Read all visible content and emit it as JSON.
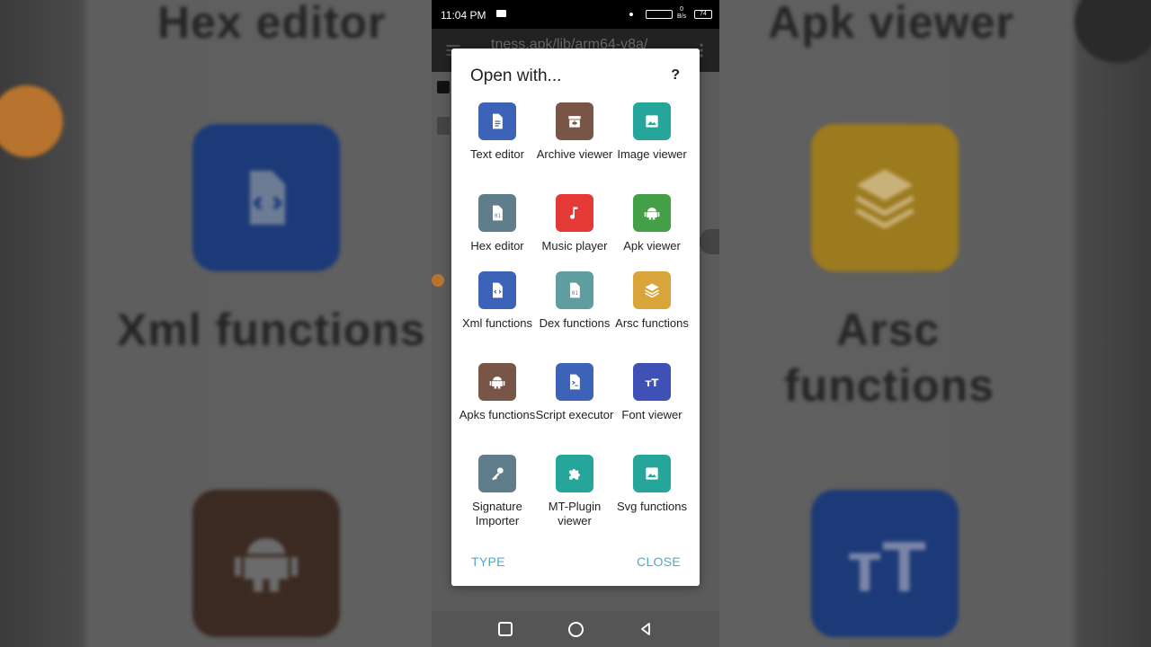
{
  "status_bar": {
    "time": "11:04 PM",
    "speed_top": "0",
    "speed_bottom": "B/s",
    "battery": "74"
  },
  "app_bar": {
    "path": "tness.apk/lib/arm64-v8a/"
  },
  "dialog": {
    "title": "Open with...",
    "help_label": "?",
    "type_button": "TYPE",
    "close_button": "CLOSE",
    "items": [
      {
        "label": "Text editor",
        "icon": "text-document-icon",
        "color": "#3d63b8"
      },
      {
        "label": "Archive viewer",
        "icon": "archive-box-icon",
        "color": "#795548"
      },
      {
        "label": "Image viewer",
        "icon": "image-icon",
        "color": "#26a69a"
      },
      {
        "label": "Hex editor",
        "icon": "binary-file-icon",
        "color": "#607d8b"
      },
      {
        "label": "Music player",
        "icon": "music-note-icon",
        "color": "#e53935"
      },
      {
        "label": "Apk viewer",
        "icon": "android-icon",
        "color": "#43a047"
      },
      {
        "label": "Xml functions",
        "icon": "code-file-icon",
        "color": "#3d63b8"
      },
      {
        "label": "Dex functions",
        "icon": "binary-file-icon",
        "color": "#5f9ea0"
      },
      {
        "label": "Arsc functions",
        "icon": "layers-icon",
        "color": "#d9a43a"
      },
      {
        "label": "Apks functions",
        "icon": "android-icon",
        "color": "#795548"
      },
      {
        "label": "Script executor",
        "icon": "terminal-file-icon",
        "color": "#3d63b8"
      },
      {
        "label": "Font viewer",
        "icon": "font-icon",
        "color": "#3f51b5"
      },
      {
        "label": "Signature Importer",
        "icon": "key-icon",
        "color": "#607d8b"
      },
      {
        "label": "MT-Plugin viewer",
        "icon": "puzzle-icon",
        "color": "#26a69a"
      },
      {
        "label": "Svg functions",
        "icon": "image-icon",
        "color": "#26a69a"
      }
    ]
  },
  "background": {
    "left_top_text": "Hex editor",
    "left_mid_text": "Xml functions",
    "right_top_text": "Apk viewer",
    "right_mid_text_line1": "Arsc",
    "right_mid_text_line2": "functions"
  }
}
